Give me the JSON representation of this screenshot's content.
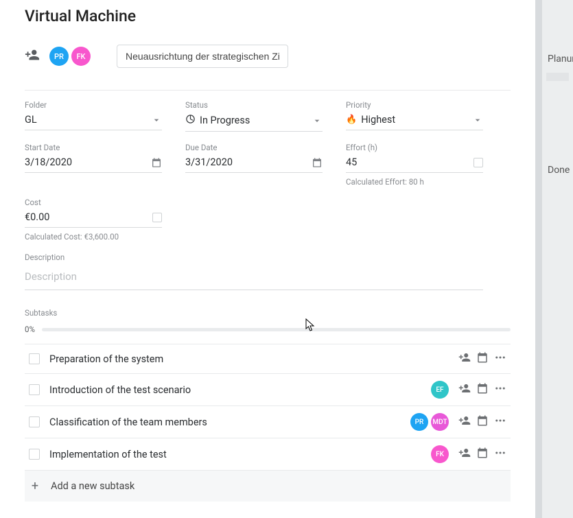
{
  "title": "Virtual Machine",
  "header": {
    "assignees": [
      {
        "initials": "PR",
        "color": "av-blue"
      },
      {
        "initials": "FK",
        "color": "av-pink"
      }
    ],
    "context_input": "Neuausrichtung der strategischen Ziele"
  },
  "fields": {
    "folder": {
      "label": "Folder",
      "value": "GL"
    },
    "status": {
      "label": "Status",
      "value": "In Progress"
    },
    "priority": {
      "label": "Priority",
      "value": "Highest"
    },
    "start_date": {
      "label": "Start Date",
      "value": "3/18/2020"
    },
    "due_date": {
      "label": "Due Date",
      "value": "3/31/2020"
    },
    "effort": {
      "label": "Effort (h)",
      "value": "45",
      "calc": "Calculated Effort: 80 h"
    },
    "cost": {
      "label": "Cost",
      "value": "€0.00",
      "calc": "Calculated Cost: €3,600.00"
    },
    "description": {
      "label": "Description",
      "placeholder": "Description"
    }
  },
  "subtasks": {
    "label": "Subtasks",
    "progress": "0%",
    "items": [
      {
        "title": "Preparation of the system",
        "assignees": []
      },
      {
        "title": "Introduction of the test scenario",
        "assignees": [
          {
            "initials": "EF",
            "color": "av-teal"
          }
        ]
      },
      {
        "title": "Classification of the team members",
        "assignees": [
          {
            "initials": "PR",
            "color": "av-blue"
          },
          {
            "initials": "MDT",
            "color": "av-purple"
          }
        ]
      },
      {
        "title": "Implementation of the test",
        "assignees": [
          {
            "initials": "FK",
            "color": "av-pink"
          }
        ]
      }
    ],
    "add_label": "Add a new subtask"
  },
  "side": {
    "planning": "Planung",
    "done": "Done"
  }
}
